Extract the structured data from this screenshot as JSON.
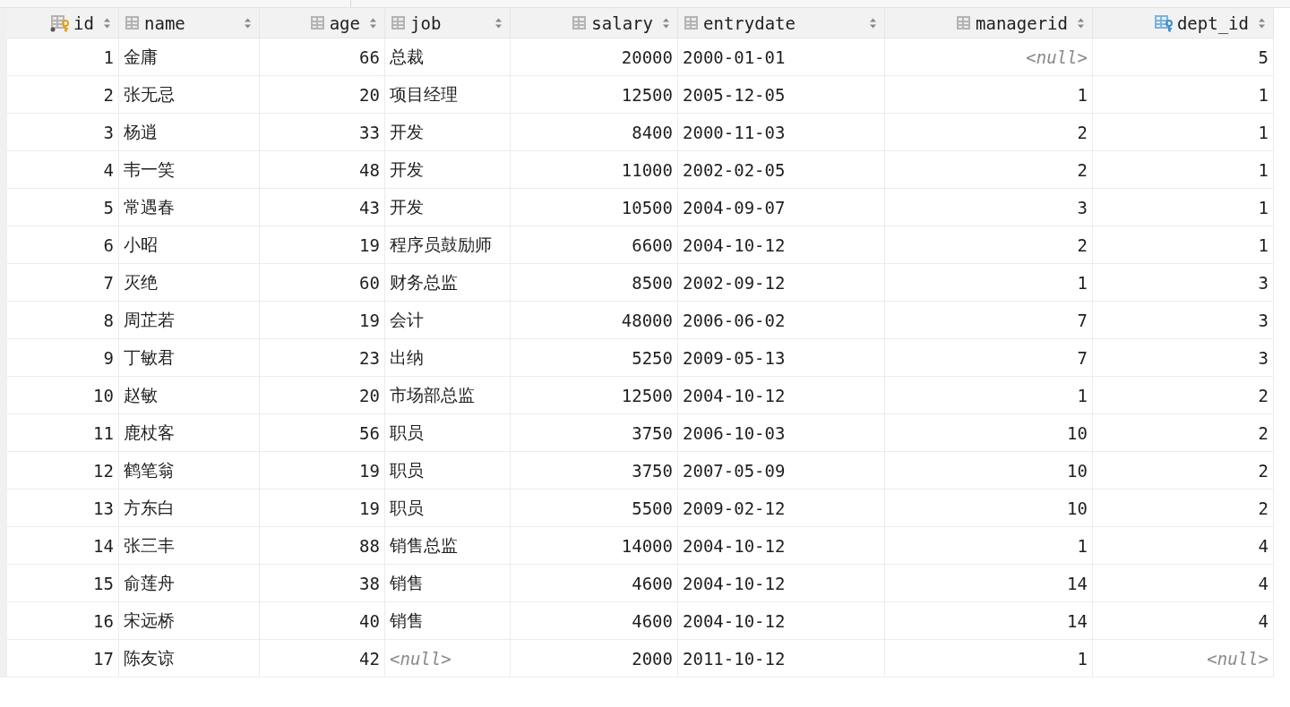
{
  "table": {
    "columns": [
      {
        "label": "id",
        "kind": "primary-key"
      },
      {
        "label": "name",
        "kind": "column"
      },
      {
        "label": "age",
        "kind": "column"
      },
      {
        "label": "job",
        "kind": "column"
      },
      {
        "label": "salary",
        "kind": "column"
      },
      {
        "label": "entrydate",
        "kind": "column"
      },
      {
        "label": "managerid",
        "kind": "column"
      },
      {
        "label": "dept_id",
        "kind": "foreign-key"
      }
    ],
    "rows": [
      {
        "cells": [
          {
            "text": "1",
            "kind": "value"
          },
          {
            "text": "金庸",
            "kind": "value"
          },
          {
            "text": "66",
            "kind": "value"
          },
          {
            "text": "总裁",
            "kind": "value"
          },
          {
            "text": "20000",
            "kind": "value"
          },
          {
            "text": "2000-01-01",
            "kind": "value"
          },
          {
            "text": "<null>",
            "kind": "null"
          },
          {
            "text": "5",
            "kind": "value"
          }
        ]
      },
      {
        "cells": [
          {
            "text": "2",
            "kind": "value"
          },
          {
            "text": "张无忌",
            "kind": "value"
          },
          {
            "text": "20",
            "kind": "value"
          },
          {
            "text": "项目经理",
            "kind": "value"
          },
          {
            "text": "12500",
            "kind": "value"
          },
          {
            "text": "2005-12-05",
            "kind": "value"
          },
          {
            "text": "1",
            "kind": "value"
          },
          {
            "text": "1",
            "kind": "value"
          }
        ]
      },
      {
        "cells": [
          {
            "text": "3",
            "kind": "value"
          },
          {
            "text": "杨逍",
            "kind": "value"
          },
          {
            "text": "33",
            "kind": "value"
          },
          {
            "text": "开发",
            "kind": "value"
          },
          {
            "text": "8400",
            "kind": "value"
          },
          {
            "text": "2000-11-03",
            "kind": "value"
          },
          {
            "text": "2",
            "kind": "value"
          },
          {
            "text": "1",
            "kind": "value"
          }
        ]
      },
      {
        "cells": [
          {
            "text": "4",
            "kind": "value"
          },
          {
            "text": "韦一笑",
            "kind": "value"
          },
          {
            "text": "48",
            "kind": "value"
          },
          {
            "text": "开发",
            "kind": "value"
          },
          {
            "text": "11000",
            "kind": "value"
          },
          {
            "text": "2002-02-05",
            "kind": "value"
          },
          {
            "text": "2",
            "kind": "value"
          },
          {
            "text": "1",
            "kind": "value"
          }
        ]
      },
      {
        "cells": [
          {
            "text": "5",
            "kind": "value"
          },
          {
            "text": "常遇春",
            "kind": "value"
          },
          {
            "text": "43",
            "kind": "value"
          },
          {
            "text": "开发",
            "kind": "value"
          },
          {
            "text": "10500",
            "kind": "value"
          },
          {
            "text": "2004-09-07",
            "kind": "value"
          },
          {
            "text": "3",
            "kind": "value"
          },
          {
            "text": "1",
            "kind": "value"
          }
        ]
      },
      {
        "cells": [
          {
            "text": "6",
            "kind": "value"
          },
          {
            "text": "小昭",
            "kind": "value"
          },
          {
            "text": "19",
            "kind": "value"
          },
          {
            "text": "程序员鼓励师",
            "kind": "value"
          },
          {
            "text": "6600",
            "kind": "value"
          },
          {
            "text": "2004-10-12",
            "kind": "value"
          },
          {
            "text": "2",
            "kind": "value"
          },
          {
            "text": "1",
            "kind": "value"
          }
        ]
      },
      {
        "cells": [
          {
            "text": "7",
            "kind": "value"
          },
          {
            "text": "灭绝",
            "kind": "value"
          },
          {
            "text": "60",
            "kind": "value"
          },
          {
            "text": "财务总监",
            "kind": "value"
          },
          {
            "text": "8500",
            "kind": "value"
          },
          {
            "text": "2002-09-12",
            "kind": "value"
          },
          {
            "text": "1",
            "kind": "value"
          },
          {
            "text": "3",
            "kind": "value"
          }
        ]
      },
      {
        "cells": [
          {
            "text": "8",
            "kind": "value"
          },
          {
            "text": "周芷若",
            "kind": "value"
          },
          {
            "text": "19",
            "kind": "value"
          },
          {
            "text": "会计",
            "kind": "value"
          },
          {
            "text": "48000",
            "kind": "value"
          },
          {
            "text": "2006-06-02",
            "kind": "value"
          },
          {
            "text": "7",
            "kind": "value"
          },
          {
            "text": "3",
            "kind": "value"
          }
        ]
      },
      {
        "cells": [
          {
            "text": "9",
            "kind": "value"
          },
          {
            "text": "丁敏君",
            "kind": "value"
          },
          {
            "text": "23",
            "kind": "value"
          },
          {
            "text": "出纳",
            "kind": "value"
          },
          {
            "text": "5250",
            "kind": "value"
          },
          {
            "text": "2009-05-13",
            "kind": "value"
          },
          {
            "text": "7",
            "kind": "value"
          },
          {
            "text": "3",
            "kind": "value"
          }
        ]
      },
      {
        "cells": [
          {
            "text": "10",
            "kind": "value"
          },
          {
            "text": "赵敏",
            "kind": "value"
          },
          {
            "text": "20",
            "kind": "value"
          },
          {
            "text": "市场部总监",
            "kind": "value"
          },
          {
            "text": "12500",
            "kind": "value"
          },
          {
            "text": "2004-10-12",
            "kind": "value"
          },
          {
            "text": "1",
            "kind": "value"
          },
          {
            "text": "2",
            "kind": "value"
          }
        ]
      },
      {
        "cells": [
          {
            "text": "11",
            "kind": "value"
          },
          {
            "text": "鹿杖客",
            "kind": "value"
          },
          {
            "text": "56",
            "kind": "value"
          },
          {
            "text": "职员",
            "kind": "value"
          },
          {
            "text": "3750",
            "kind": "value"
          },
          {
            "text": "2006-10-03",
            "kind": "value"
          },
          {
            "text": "10",
            "kind": "value"
          },
          {
            "text": "2",
            "kind": "value"
          }
        ]
      },
      {
        "cells": [
          {
            "text": "12",
            "kind": "value"
          },
          {
            "text": "鹤笔翁",
            "kind": "value"
          },
          {
            "text": "19",
            "kind": "value"
          },
          {
            "text": "职员",
            "kind": "value"
          },
          {
            "text": "3750",
            "kind": "value"
          },
          {
            "text": "2007-05-09",
            "kind": "value"
          },
          {
            "text": "10",
            "kind": "value"
          },
          {
            "text": "2",
            "kind": "value"
          }
        ]
      },
      {
        "cells": [
          {
            "text": "13",
            "kind": "value"
          },
          {
            "text": "方东白",
            "kind": "value"
          },
          {
            "text": "19",
            "kind": "value"
          },
          {
            "text": "职员",
            "kind": "value"
          },
          {
            "text": "5500",
            "kind": "value"
          },
          {
            "text": "2009-02-12",
            "kind": "value"
          },
          {
            "text": "10",
            "kind": "value"
          },
          {
            "text": "2",
            "kind": "value"
          }
        ]
      },
      {
        "cells": [
          {
            "text": "14",
            "kind": "value"
          },
          {
            "text": "张三丰",
            "kind": "value"
          },
          {
            "text": "88",
            "kind": "value"
          },
          {
            "text": "销售总监",
            "kind": "value"
          },
          {
            "text": "14000",
            "kind": "value"
          },
          {
            "text": "2004-10-12",
            "kind": "value"
          },
          {
            "text": "1",
            "kind": "value"
          },
          {
            "text": "4",
            "kind": "value"
          }
        ]
      },
      {
        "cells": [
          {
            "text": "15",
            "kind": "value"
          },
          {
            "text": "俞莲舟",
            "kind": "value"
          },
          {
            "text": "38",
            "kind": "value"
          },
          {
            "text": "销售",
            "kind": "value"
          },
          {
            "text": "4600",
            "kind": "value"
          },
          {
            "text": "2004-10-12",
            "kind": "value"
          },
          {
            "text": "14",
            "kind": "value"
          },
          {
            "text": "4",
            "kind": "value"
          }
        ]
      },
      {
        "cells": [
          {
            "text": "16",
            "kind": "value"
          },
          {
            "text": "宋远桥",
            "kind": "value"
          },
          {
            "text": "40",
            "kind": "value"
          },
          {
            "text": "销售",
            "kind": "value"
          },
          {
            "text": "4600",
            "kind": "value"
          },
          {
            "text": "2004-10-12",
            "kind": "value"
          },
          {
            "text": "14",
            "kind": "value"
          },
          {
            "text": "4",
            "kind": "value"
          }
        ]
      },
      {
        "cells": [
          {
            "text": "17",
            "kind": "value"
          },
          {
            "text": "陈友谅",
            "kind": "value"
          },
          {
            "text": "42",
            "kind": "value"
          },
          {
            "text": "<null>",
            "kind": "null"
          },
          {
            "text": "2000",
            "kind": "value"
          },
          {
            "text": "2011-10-12",
            "kind": "value"
          },
          {
            "text": "1",
            "kind": "value"
          },
          {
            "text": "<null>",
            "kind": "null"
          }
        ]
      }
    ]
  }
}
